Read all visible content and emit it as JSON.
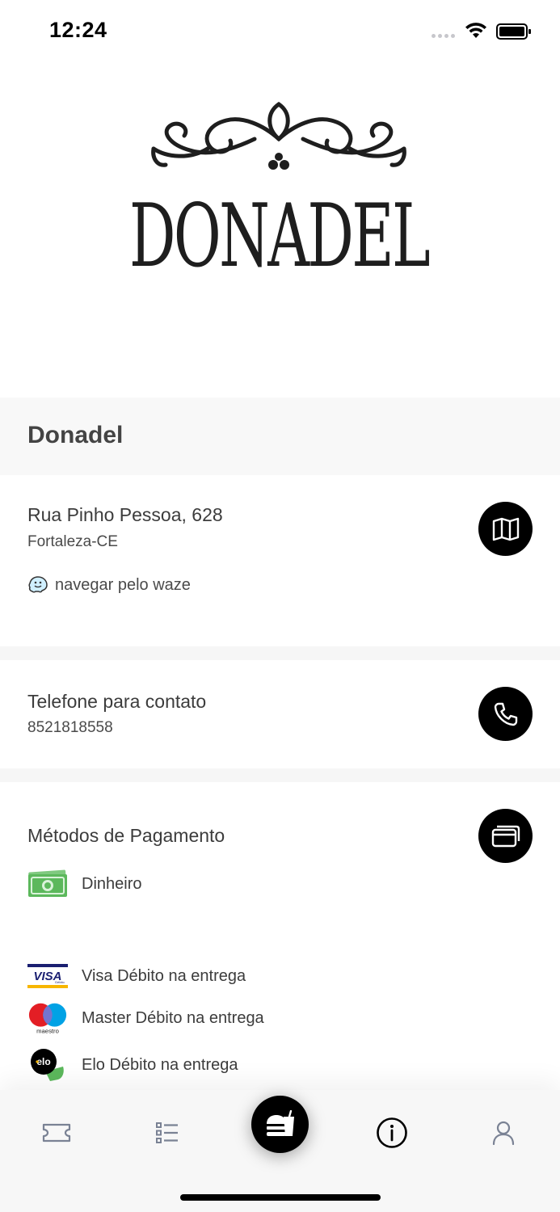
{
  "status_bar": {
    "time": "12:24"
  },
  "logo": {
    "wordmark": "DONADEL"
  },
  "header": {
    "restaurant_name": "Donadel"
  },
  "address": {
    "street": "Rua Pinho Pessoa, 628",
    "city": "Fortaleza-CE",
    "waze_label": "navegar pelo waze",
    "map_icon": "map-icon"
  },
  "phone": {
    "title": "Telefone para contato",
    "number": "8521818558",
    "phone_icon": "phone-icon"
  },
  "payment": {
    "title": "Métodos de Pagamento",
    "card_icon": "credit-card-icon",
    "methods": [
      {
        "label": "Dinheiro",
        "icon": "cash-icon"
      },
      {
        "label": "Visa Débito na entrega",
        "icon": "visa-icon"
      },
      {
        "label": "Master Débito na entrega",
        "icon": "maestro-icon"
      },
      {
        "label": "Elo Débito na entrega",
        "icon": "elo-icon"
      }
    ]
  },
  "tab_bar": {
    "tabs": [
      {
        "icon": "ticket-icon",
        "active": false
      },
      {
        "icon": "list-icon",
        "active": false
      },
      {
        "icon": "food-icon",
        "active": false
      },
      {
        "icon": "info-icon",
        "active": true
      },
      {
        "icon": "user-icon",
        "active": false
      }
    ]
  },
  "colors": {
    "accent": "#000000",
    "waze": "#33ccff",
    "visa_blue": "#1a1f71",
    "visa_gold": "#f7b600",
    "cash_green": "#5cb85c"
  }
}
